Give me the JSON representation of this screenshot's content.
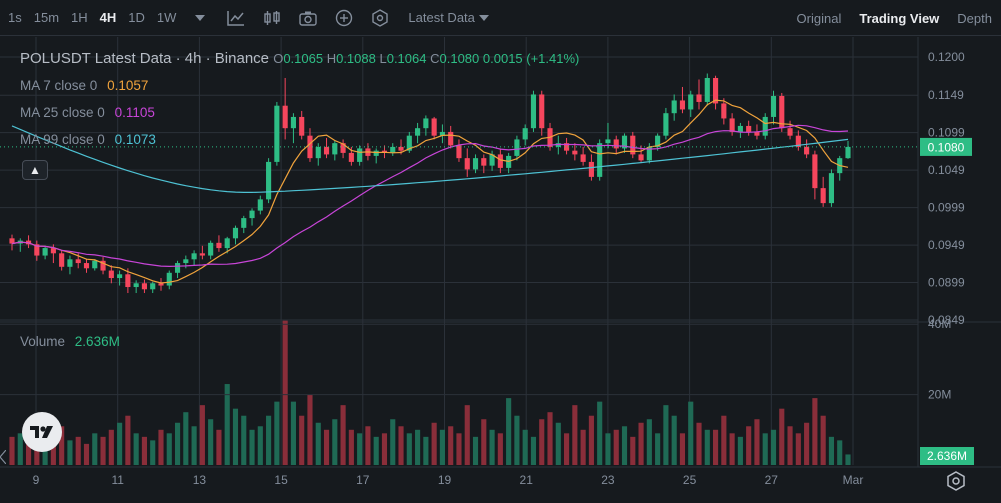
{
  "toolbar": {
    "intervals": [
      "1s",
      "15m",
      "1H",
      "4H",
      "1D",
      "1W"
    ],
    "active_interval": "4H",
    "price_type": "Latest Data",
    "views": [
      "Original",
      "Trading View",
      "Depth"
    ],
    "active_view": "Trading View"
  },
  "legend": {
    "symbol": "POLUSDT Latest Data · 4h · Binance",
    "open_label": "O",
    "open": "0.1065",
    "high_label": "H",
    "high": "0.1088",
    "low_label": "L",
    "low": "0.1064",
    "close_label": "C",
    "close": "0.1080",
    "change": "0.0015 (+1.41%)",
    "ma": [
      {
        "label": "MA 7 close 0",
        "value": "0.1057",
        "color": "#f0a33c"
      },
      {
        "label": "MA 25 close 0",
        "value": "0.1105",
        "color": "#c845d8"
      },
      {
        "label": "MA 99 close 0",
        "value": "0.1073",
        "color": "#4ec2d4"
      }
    ],
    "collapse_icon": "▲"
  },
  "volume_legend": {
    "label": "Volume",
    "value": "2.636M"
  },
  "price_axis": [
    "0.1200",
    "0.1149",
    "0.1099",
    "0.1049",
    "0.0999",
    "0.0949",
    "0.0899",
    "0.0849"
  ],
  "current_price": "0.1080",
  "volume_axis": [
    "40M",
    "20M"
  ],
  "current_volume": "2.636M",
  "date_axis": [
    "9",
    "11",
    "13",
    "15",
    "17",
    "19",
    "21",
    "23",
    "25",
    "27",
    "Mar"
  ],
  "colors": {
    "up": "#2ebd85",
    "down": "#f6465d",
    "bg": "#161a1e",
    "grid": "#2b3139"
  },
  "chart_data": {
    "type": "candlestick",
    "interval": "4h",
    "ylim": [
      0.0849,
      0.12
    ],
    "candles": [
      [
        0.0958,
        0.0963,
        0.0942,
        0.0951
      ],
      [
        0.0951,
        0.0958,
        0.094,
        0.0955
      ],
      [
        0.0955,
        0.0962,
        0.0945,
        0.095
      ],
      [
        0.095,
        0.0955,
        0.0928,
        0.0935
      ],
      [
        0.0935,
        0.0948,
        0.093,
        0.0945
      ],
      [
        0.0945,
        0.095,
        0.0925,
        0.0938
      ],
      [
        0.0938,
        0.0942,
        0.0915,
        0.092
      ],
      [
        0.092,
        0.0935,
        0.091,
        0.093
      ],
      [
        0.093,
        0.0938,
        0.0918,
        0.0925
      ],
      [
        0.0925,
        0.0931,
        0.0912,
        0.0918
      ],
      [
        0.0918,
        0.093,
        0.0915,
        0.0928
      ],
      [
        0.0928,
        0.0933,
        0.091,
        0.0915
      ],
      [
        0.0915,
        0.0922,
        0.0898,
        0.0905
      ],
      [
        0.0905,
        0.0915,
        0.0895,
        0.091
      ],
      [
        0.091,
        0.0918,
        0.0885,
        0.0893
      ],
      [
        0.0893,
        0.0902,
        0.0885,
        0.0898
      ],
      [
        0.0898,
        0.0903,
        0.0885,
        0.089
      ],
      [
        0.089,
        0.09,
        0.0885,
        0.0898
      ],
      [
        0.0898,
        0.0905,
        0.0888,
        0.0895
      ],
      [
        0.0895,
        0.0915,
        0.089,
        0.0912
      ],
      [
        0.0912,
        0.0928,
        0.0905,
        0.0925
      ],
      [
        0.0925,
        0.0935,
        0.0918,
        0.093
      ],
      [
        0.093,
        0.0942,
        0.0922,
        0.0938
      ],
      [
        0.0938,
        0.0948,
        0.093,
        0.0935
      ],
      [
        0.0935,
        0.0955,
        0.093,
        0.0952
      ],
      [
        0.0952,
        0.0962,
        0.094,
        0.0945
      ],
      [
        0.0945,
        0.096,
        0.0938,
        0.0958
      ],
      [
        0.0958,
        0.0975,
        0.095,
        0.0972
      ],
      [
        0.0972,
        0.0988,
        0.0965,
        0.0985
      ],
      [
        0.0985,
        0.0998,
        0.0975,
        0.0995
      ],
      [
        0.0995,
        0.1015,
        0.099,
        0.101
      ],
      [
        0.101,
        0.1065,
        0.1005,
        0.106
      ],
      [
        0.106,
        0.114,
        0.1055,
        0.1135
      ],
      [
        0.1135,
        0.1172,
        0.109,
        0.1105
      ],
      [
        0.1105,
        0.1125,
        0.1085,
        0.112
      ],
      [
        0.112,
        0.1128,
        0.109,
        0.1095
      ],
      [
        0.1095,
        0.1105,
        0.106,
        0.1065
      ],
      [
        0.1065,
        0.1085,
        0.1055,
        0.108
      ],
      [
        0.108,
        0.1092,
        0.1065,
        0.107
      ],
      [
        0.107,
        0.1088,
        0.1062,
        0.1085
      ],
      [
        0.1085,
        0.109,
        0.1065,
        0.1072
      ],
      [
        0.1072,
        0.108,
        0.1055,
        0.106
      ],
      [
        0.106,
        0.1082,
        0.1055,
        0.1078
      ],
      [
        0.1078,
        0.1085,
        0.1062,
        0.1068
      ],
      [
        0.1068,
        0.1078,
        0.1058,
        0.1075
      ],
      [
        0.1075,
        0.1082,
        0.1065,
        0.1072
      ],
      [
        0.1072,
        0.1085,
        0.1068,
        0.108
      ],
      [
        0.108,
        0.109,
        0.107,
        0.1075
      ],
      [
        0.1075,
        0.11,
        0.1072,
        0.1095
      ],
      [
        0.1095,
        0.1112,
        0.1085,
        0.1105
      ],
      [
        0.1105,
        0.1122,
        0.1095,
        0.1118
      ],
      [
        0.1118,
        0.112,
        0.109,
        0.1095
      ],
      [
        0.1095,
        0.111,
        0.1085,
        0.11
      ],
      [
        0.11,
        0.1108,
        0.1078,
        0.1082
      ],
      [
        0.1082,
        0.109,
        0.106,
        0.1065
      ],
      [
        0.1065,
        0.1078,
        0.104,
        0.105
      ],
      [
        0.105,
        0.107,
        0.1045,
        0.1065
      ],
      [
        0.1065,
        0.107,
        0.1045,
        0.1055
      ],
      [
        0.1055,
        0.1075,
        0.1048,
        0.107
      ],
      [
        0.107,
        0.1078,
        0.1045,
        0.1052
      ],
      [
        0.1052,
        0.1072,
        0.1045,
        0.1068
      ],
      [
        0.1068,
        0.1095,
        0.1062,
        0.109
      ],
      [
        0.109,
        0.111,
        0.1082,
        0.1105
      ],
      [
        0.1105,
        0.1155,
        0.11,
        0.115
      ],
      [
        0.115,
        0.1155,
        0.1095,
        0.1105
      ],
      [
        0.1105,
        0.1112,
        0.1075,
        0.108
      ],
      [
        0.108,
        0.1095,
        0.107,
        0.1085
      ],
      [
        0.1085,
        0.1092,
        0.107,
        0.1075
      ],
      [
        0.1075,
        0.1085,
        0.1062,
        0.107
      ],
      [
        0.107,
        0.108,
        0.1055,
        0.106
      ],
      [
        0.106,
        0.107,
        0.1035,
        0.104
      ],
      [
        0.104,
        0.109,
        0.1035,
        0.1085
      ],
      [
        0.1085,
        0.1112,
        0.1078,
        0.109
      ],
      [
        0.109,
        0.1095,
        0.107,
        0.1078
      ],
      [
        0.1078,
        0.1098,
        0.1072,
        0.1095
      ],
      [
        0.1095,
        0.11,
        0.1065,
        0.107
      ],
      [
        0.107,
        0.1082,
        0.106,
        0.1062
      ],
      [
        0.1062,
        0.1085,
        0.1058,
        0.108
      ],
      [
        0.108,
        0.1098,
        0.1075,
        0.1095
      ],
      [
        0.1095,
        0.1132,
        0.109,
        0.1125
      ],
      [
        0.1125,
        0.115,
        0.1115,
        0.1142
      ],
      [
        0.1142,
        0.116,
        0.1125,
        0.113
      ],
      [
        0.113,
        0.1155,
        0.112,
        0.115
      ],
      [
        0.115,
        0.117,
        0.113,
        0.114
      ],
      [
        0.114,
        0.1178,
        0.1135,
        0.1172
      ],
      [
        0.1172,
        0.1175,
        0.113,
        0.1138
      ],
      [
        0.1138,
        0.1145,
        0.111,
        0.1118
      ],
      [
        0.1118,
        0.1125,
        0.1095,
        0.11
      ],
      [
        0.11,
        0.1112,
        0.1092,
        0.1108
      ],
      [
        0.1108,
        0.1115,
        0.1095,
        0.11
      ],
      [
        0.11,
        0.111,
        0.109,
        0.1095
      ],
      [
        0.1095,
        0.1125,
        0.109,
        0.112
      ],
      [
        0.112,
        0.1155,
        0.111,
        0.1148
      ],
      [
        0.1148,
        0.1152,
        0.11,
        0.1105
      ],
      [
        0.1105,
        0.1115,
        0.109,
        0.1095
      ],
      [
        0.1095,
        0.1102,
        0.1075,
        0.108
      ],
      [
        0.108,
        0.109,
        0.1065,
        0.107
      ],
      [
        0.107,
        0.1075,
        0.101,
        0.1025
      ],
      [
        0.1025,
        0.104,
        0.1,
        0.1005
      ],
      [
        0.1005,
        0.105,
        0.1,
        0.1045
      ],
      [
        0.1045,
        0.1068,
        0.1035,
        0.1065
      ],
      [
        0.1065,
        0.1088,
        0.1064,
        0.108
      ]
    ],
    "volume_max_m": 40,
    "volume_m": [
      8,
      9,
      7,
      10,
      8,
      9,
      11,
      7,
      8,
      6,
      9,
      8,
      10,
      12,
      14,
      9,
      8,
      7,
      10,
      9,
      12,
      15,
      11,
      17,
      13,
      10,
      23,
      16,
      14,
      10,
      11,
      14,
      18,
      41,
      18,
      14,
      20,
      12,
      10,
      13,
      17,
      10,
      9,
      11,
      8,
      9,
      13,
      11,
      9,
      10,
      8,
      12,
      10,
      11,
      9,
      17,
      8,
      13,
      10,
      9,
      19,
      14,
      10,
      8,
      13,
      15,
      12,
      9,
      17,
      10,
      14,
      18,
      9,
      10,
      11,
      8,
      12,
      13,
      9,
      17,
      14,
      9,
      18,
      12,
      10,
      10,
      14,
      9,
      8,
      11,
      13,
      9,
      10,
      16,
      11,
      9,
      12,
      19,
      14,
      8,
      7,
      3
    ]
  }
}
